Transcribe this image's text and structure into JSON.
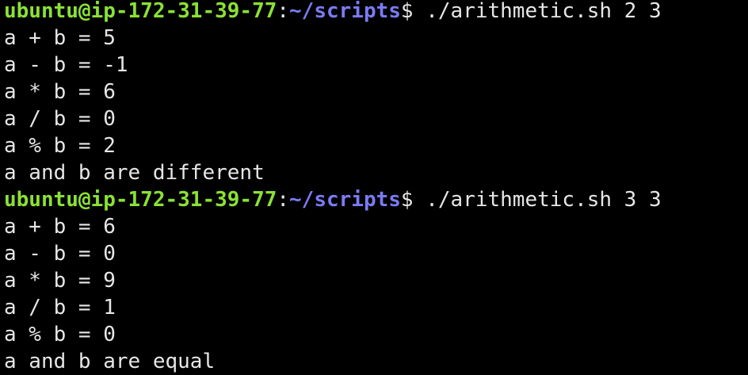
{
  "terminal": {
    "colors": {
      "background": "#000000",
      "foreground": "#e6e6e6",
      "prompt_user": "#8ae234",
      "prompt_path": "#7b7bf5"
    },
    "lines": [
      {
        "type": "prompt",
        "user": "ubuntu@ip-172-31-39-77",
        "colon": ":",
        "path": "~/scripts",
        "dollar": "$",
        "command": " ./arithmetic.sh 2 3"
      },
      {
        "type": "output",
        "text": "a + b = 5"
      },
      {
        "type": "output",
        "text": "a - b = -1"
      },
      {
        "type": "output",
        "text": "a * b = 6"
      },
      {
        "type": "output",
        "text": "a / b = 0"
      },
      {
        "type": "output",
        "text": "a % b = 2"
      },
      {
        "type": "output",
        "text": "a and b are different"
      },
      {
        "type": "prompt",
        "user": "ubuntu@ip-172-31-39-77",
        "colon": ":",
        "path": "~/scripts",
        "dollar": "$",
        "command": " ./arithmetic.sh 3 3"
      },
      {
        "type": "output",
        "text": "a + b = 6"
      },
      {
        "type": "output",
        "text": "a - b = 0"
      },
      {
        "type": "output",
        "text": "a * b = 9"
      },
      {
        "type": "output",
        "text": "a / b = 1"
      },
      {
        "type": "output",
        "text": "a % b = 0"
      },
      {
        "type": "output",
        "text": "a and b are equal"
      }
    ]
  }
}
